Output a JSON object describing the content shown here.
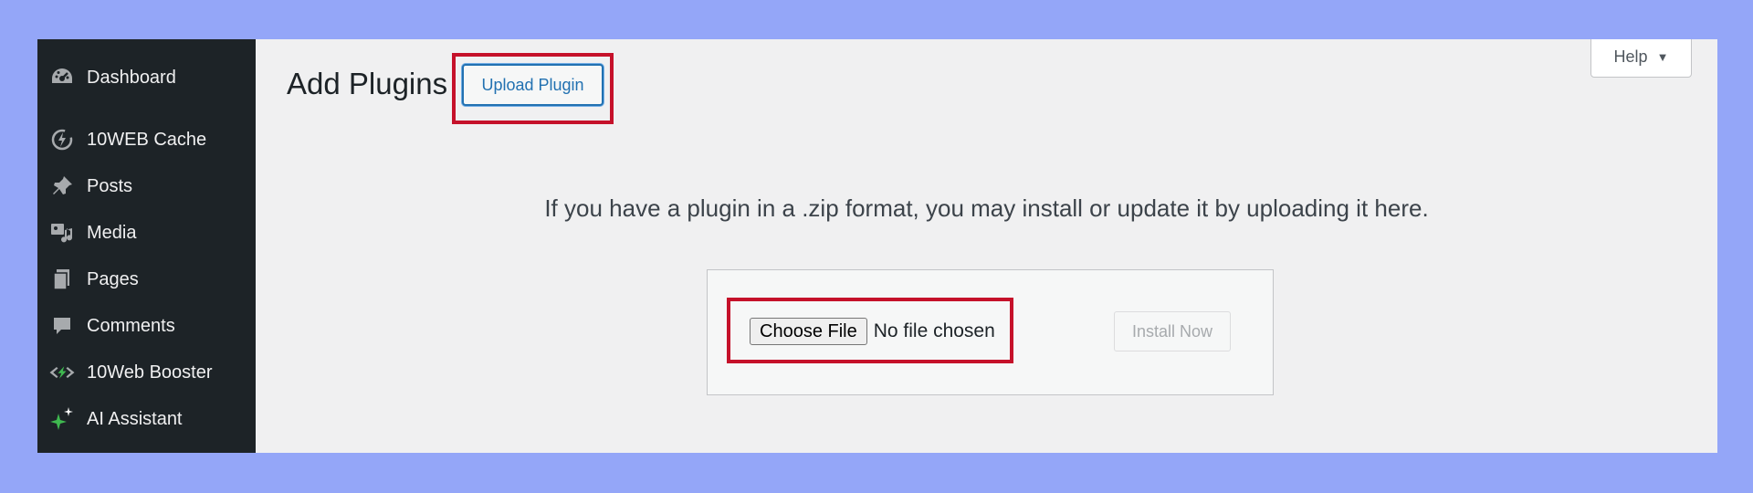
{
  "colors": {
    "page_background": "#94a6f8",
    "sidebar_background": "#1d2327",
    "content_background": "#f0f0f1",
    "accent": "#2271b1",
    "highlight": "#c5112a",
    "ai_icon": "#3fb950"
  },
  "sidebar": {
    "items": [
      {
        "label": "Dashboard",
        "icon": "dashboard-icon"
      },
      {
        "label": "10WEB Cache",
        "icon": "cache-icon"
      },
      {
        "label": "Posts",
        "icon": "pin-icon"
      },
      {
        "label": "Media",
        "icon": "media-icon"
      },
      {
        "label": "Pages",
        "icon": "pages-icon"
      },
      {
        "label": "Comments",
        "icon": "comment-icon"
      },
      {
        "label": "10Web Booster",
        "icon": "booster-icon"
      },
      {
        "label": "AI Assistant",
        "icon": "sparkle-icon"
      }
    ]
  },
  "header": {
    "title": "Add Plugins",
    "upload_button_label": "Upload Plugin",
    "help_label": "Help",
    "help_caret": "▼"
  },
  "upload": {
    "help_text": "If you have a plugin in a .zip format, you may install or update it by uploading it here.",
    "choose_file_label": "Choose File",
    "file_status": "No file chosen",
    "install_label": "Install Now"
  }
}
